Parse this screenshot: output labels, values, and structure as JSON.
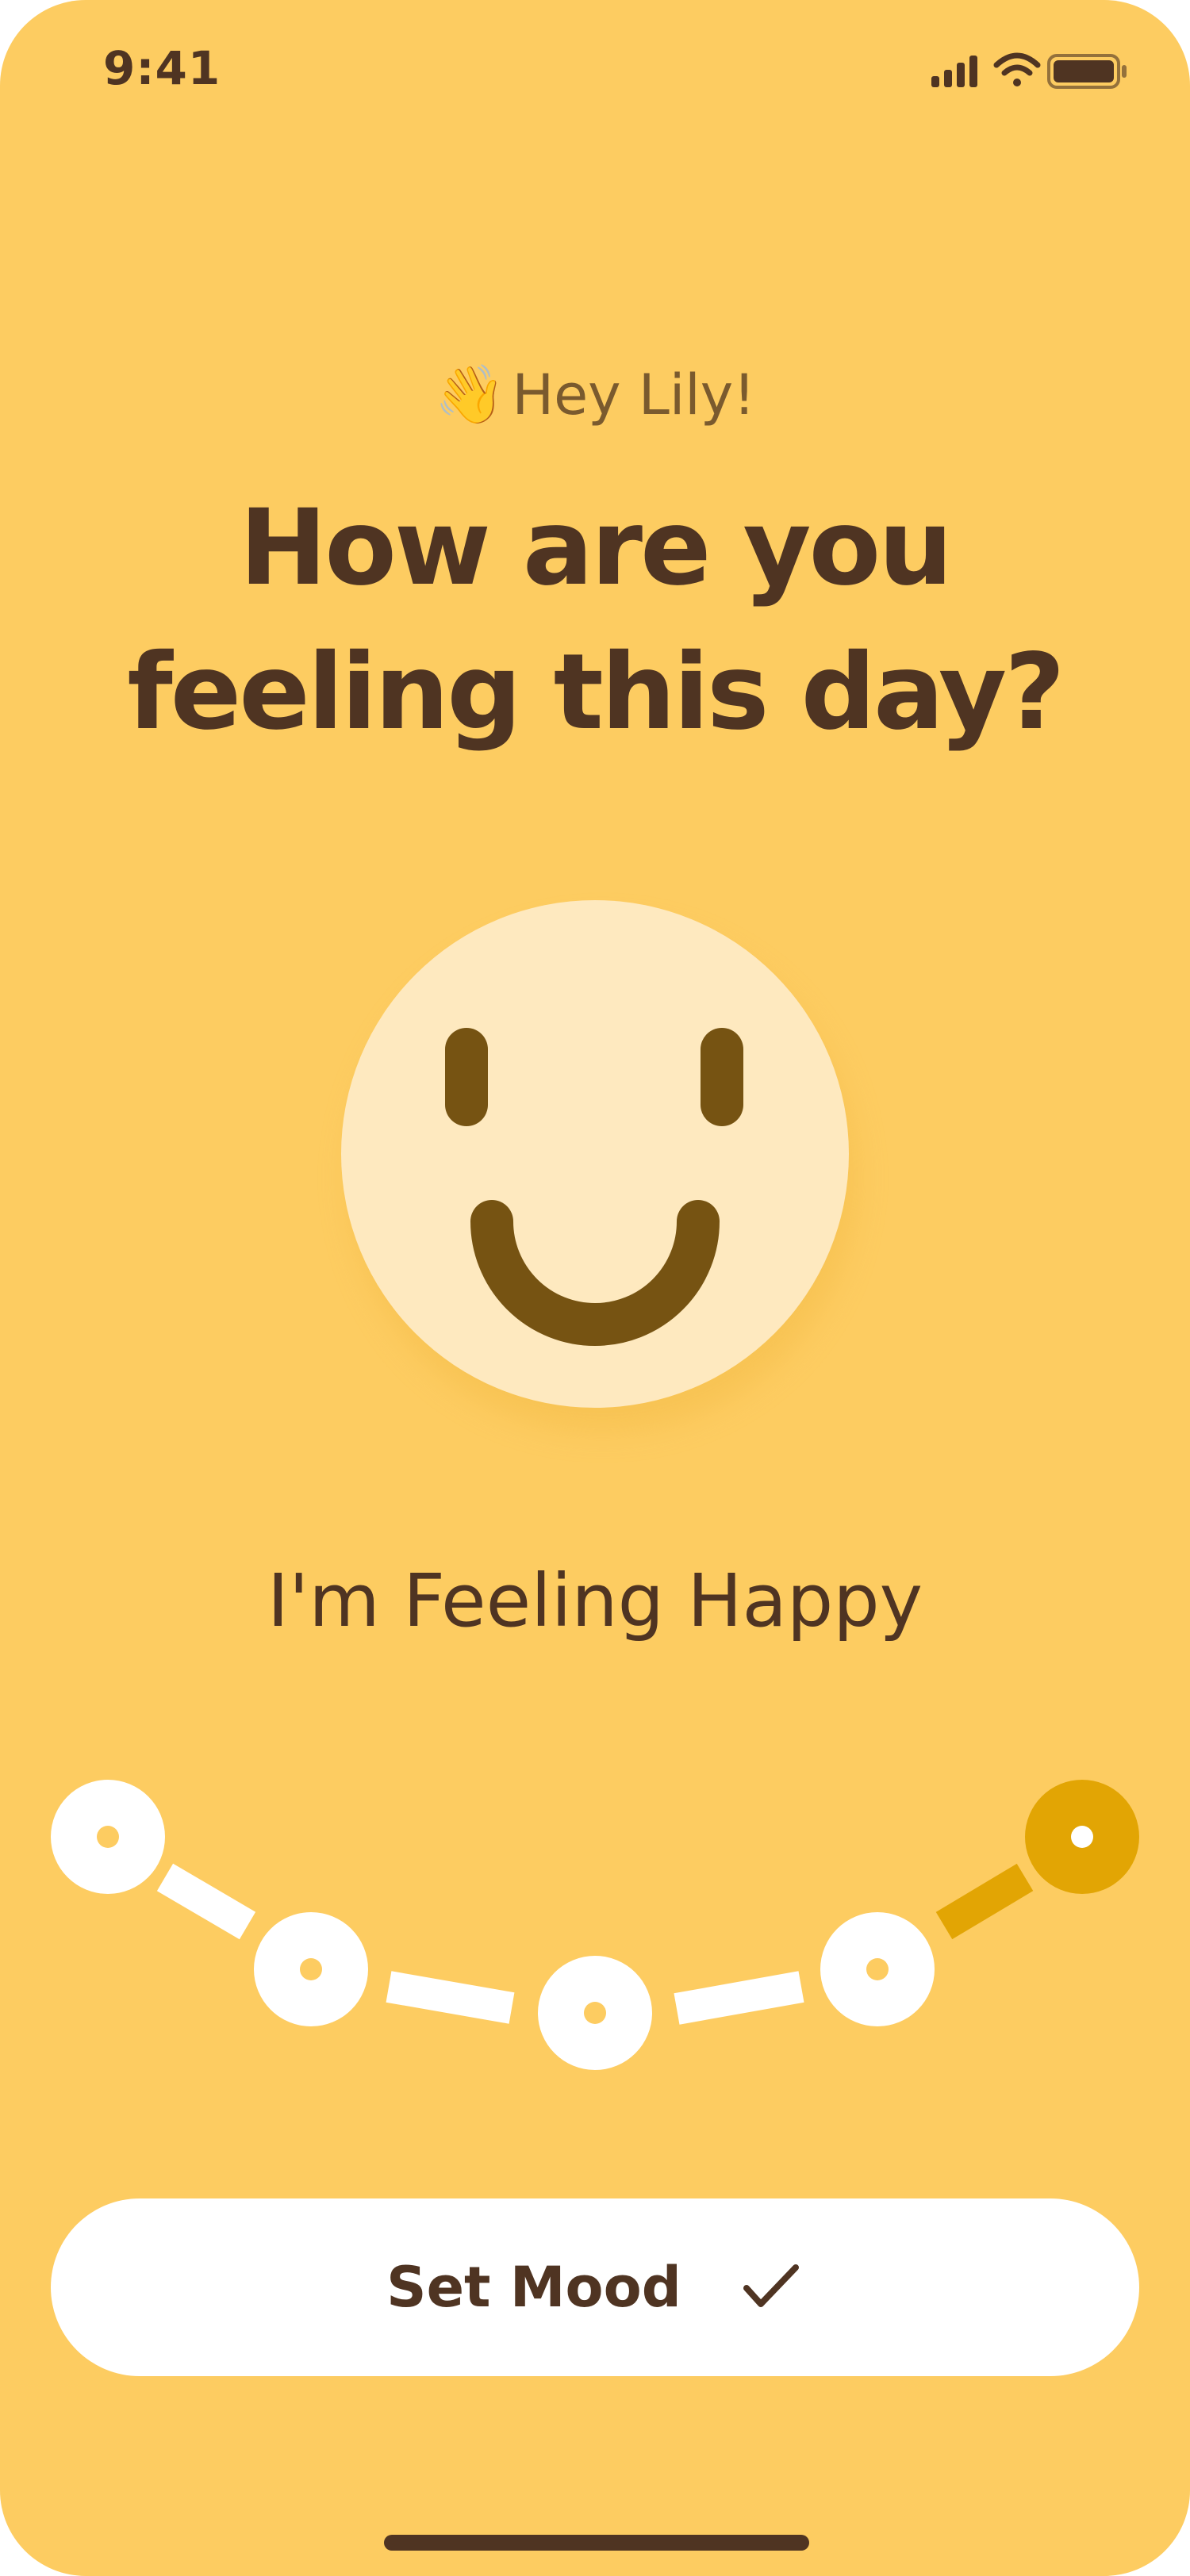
{
  "status_bar": {
    "time": "9:41"
  },
  "greeting": {
    "emoji": "👋",
    "text": "Hey Lily!"
  },
  "headline": "How are you feeling this day?",
  "mood": {
    "label": "I'm Feeling Happy",
    "options_count": 6,
    "selected_index": 5
  },
  "button": {
    "label": "Set Mood"
  },
  "colors": {
    "background": "#FDCC61",
    "face": "#FEE9BF",
    "face_features": "#765312",
    "text": "#4F3422",
    "selected_accent": "#E2A504",
    "track": "#FFFFFF"
  },
  "icons": {
    "check": "checkmark-icon",
    "wifi": "wifi-icon",
    "signal": "signal-icon",
    "battery": "battery-icon"
  }
}
